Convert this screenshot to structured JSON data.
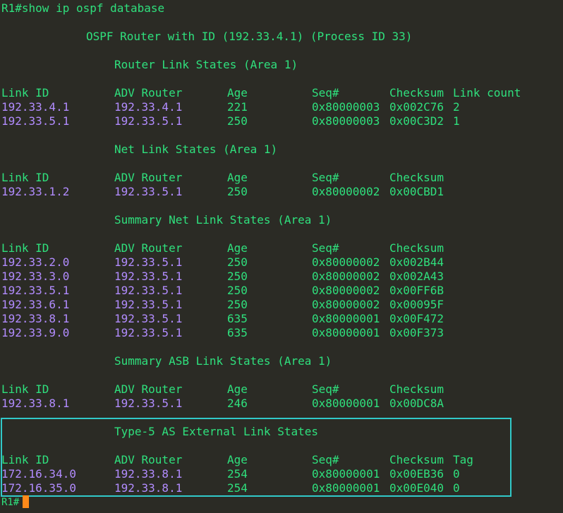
{
  "terminal": {
    "command_line": "R1#show ip ospf database",
    "header": "OSPF Router with ID (192.33.4.1) (Process ID 33)",
    "final_prompt": "R1#",
    "colors": {
      "background": "#2b2b25",
      "text_green": "#2fe07d",
      "text_purple": "#b28cff",
      "highlight_box": "#31c9c9",
      "cursor": "#ff8a1a"
    }
  },
  "sections": [
    {
      "title": "Router Link States (Area 1)",
      "columns": [
        "Link ID",
        "ADV Router",
        "Age",
        "Seq#",
        "Checksum",
        "Link count"
      ],
      "rows": [
        [
          "192.33.4.1",
          "192.33.4.1",
          "221",
          "0x80000003",
          "0x002C76",
          "2"
        ],
        [
          "192.33.5.1",
          "192.33.5.1",
          "250",
          "0x80000003",
          "0x00C3D2",
          "1"
        ]
      ]
    },
    {
      "title": "Net Link States (Area 1)",
      "columns": [
        "Link ID",
        "ADV Router",
        "Age",
        "Seq#",
        "Checksum"
      ],
      "rows": [
        [
          "192.33.1.2",
          "192.33.5.1",
          "250",
          "0x80000002",
          "0x00CBD1"
        ]
      ]
    },
    {
      "title": "Summary Net Link States (Area 1)",
      "columns": [
        "Link ID",
        "ADV Router",
        "Age",
        "Seq#",
        "Checksum"
      ],
      "rows": [
        [
          "192.33.2.0",
          "192.33.5.1",
          "250",
          "0x80000002",
          "0x002B44"
        ],
        [
          "192.33.3.0",
          "192.33.5.1",
          "250",
          "0x80000002",
          "0x002A43"
        ],
        [
          "192.33.5.1",
          "192.33.5.1",
          "250",
          "0x80000002",
          "0x00FF6B"
        ],
        [
          "192.33.6.1",
          "192.33.5.1",
          "250",
          "0x80000002",
          "0x00095F"
        ],
        [
          "192.33.8.1",
          "192.33.5.1",
          "635",
          "0x80000001",
          "0x00F472"
        ],
        [
          "192.33.9.0",
          "192.33.5.1",
          "635",
          "0x80000001",
          "0x00F373"
        ]
      ]
    },
    {
      "title": "Summary ASB Link States (Area 1)",
      "columns": [
        "Link ID",
        "ADV Router",
        "Age",
        "Seq#",
        "Checksum"
      ],
      "rows": [
        [
          "192.33.8.1",
          "192.33.5.1",
          "246",
          "0x80000001",
          "0x00DC8A"
        ]
      ]
    },
    {
      "title": "Type-5 AS External Link States",
      "columns": [
        "Link ID",
        "ADV Router",
        "Age",
        "Seq#",
        "Checksum",
        "Tag"
      ],
      "rows": [
        [
          "172.16.34.0",
          "192.33.8.1",
          "254",
          "0x80000001",
          "0x00EB36",
          "0"
        ],
        [
          "172.16.35.0",
          "192.33.8.1",
          "254",
          "0x80000001",
          "0x00E040",
          "0"
        ]
      ]
    }
  ]
}
